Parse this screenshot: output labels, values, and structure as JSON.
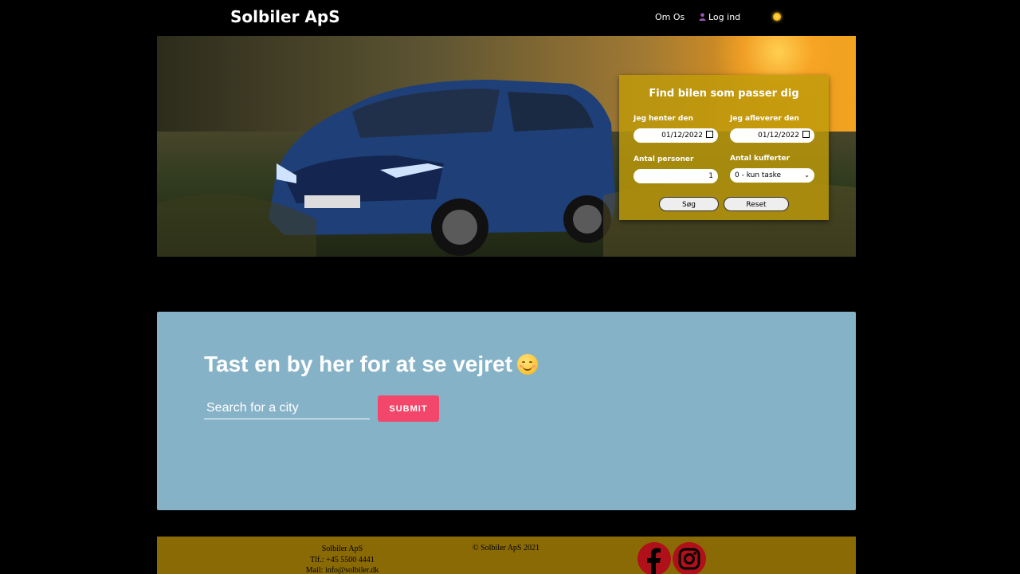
{
  "header": {
    "brand": "Solbiler ApS",
    "nav_about": "Om Os",
    "nav_login": "Log ind",
    "icons": [
      "user-icon",
      "sun-icon"
    ]
  },
  "hero": {
    "image": "blue Nissan SUV in a grassy field at sunset",
    "search": {
      "title": "Find bilen som passer dig",
      "pickup_label": "Jeg henter den",
      "pickup_value": "01/12/2022",
      "dropoff_label": "Jeg afleverer den",
      "dropoff_value": "01/12/2022",
      "persons_label": "Antal personer",
      "persons_value": "1",
      "suitcases_label": "Antal kufferter",
      "suitcases_value": "0 - kun taske",
      "search_button": "Søg",
      "reset_button": "Reset"
    }
  },
  "weather": {
    "title": "Tast en by her for at se vejret",
    "emoji": "smiling-face-icon",
    "city_placeholder": "Search for a city",
    "submit_label": "SUBMIT"
  },
  "footer": {
    "company": "Solbiler ApS",
    "phone": "Tlf.: +45 5500 4441",
    "mail": "Mail: info@solbiler.dk",
    "copyright": "© Solbiler ApS 2021",
    "social": [
      "facebook-icon",
      "instagram-icon"
    ]
  },
  "colors": {
    "background": "#000000",
    "search_panel": "#be9b0a",
    "weather_bg": "#86b2c8",
    "submit": "#f2476a",
    "footer": "#8a6a05",
    "social": "#b0101a"
  }
}
